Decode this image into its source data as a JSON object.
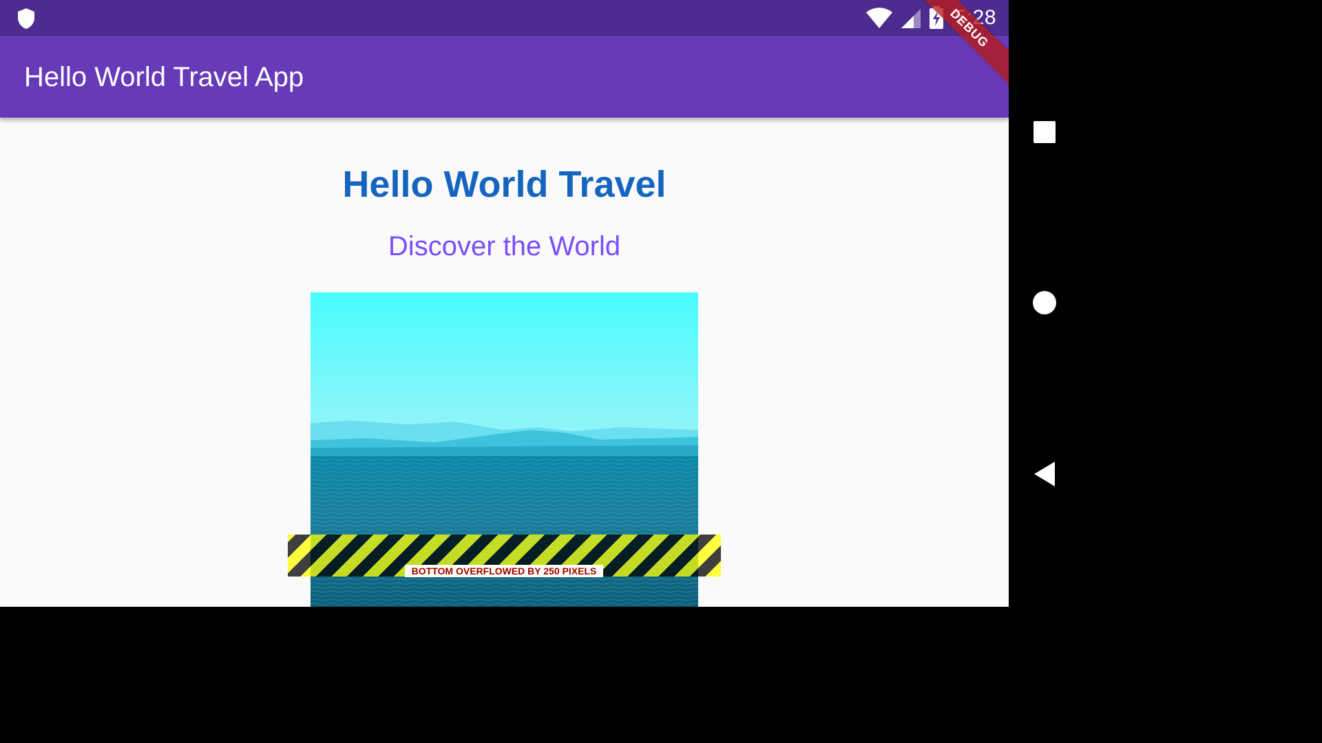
{
  "status_bar": {
    "time": "5:28",
    "icons": [
      "shield-icon",
      "wifi-icon",
      "signal-icon",
      "battery-charging-icon"
    ]
  },
  "app_bar": {
    "title": "Hello World Travel App"
  },
  "debug_banner": {
    "label": "DEBUG"
  },
  "content": {
    "heading": "Hello World Travel",
    "subheading": "Discover the World",
    "image": "sea-landscape-image"
  },
  "overflow_warning": {
    "text": "BOTTOM OVERFLOWED BY 250 PIXELS"
  },
  "nav_bar": {
    "buttons": [
      "recents-square-icon",
      "home-circle-icon",
      "back-triangle-icon"
    ]
  },
  "colors": {
    "status_bar": "#4e2b8e",
    "app_bar": "#673ab7",
    "heading": "#1565c0",
    "subheading": "#7c4dff",
    "background": "#fafafa"
  }
}
